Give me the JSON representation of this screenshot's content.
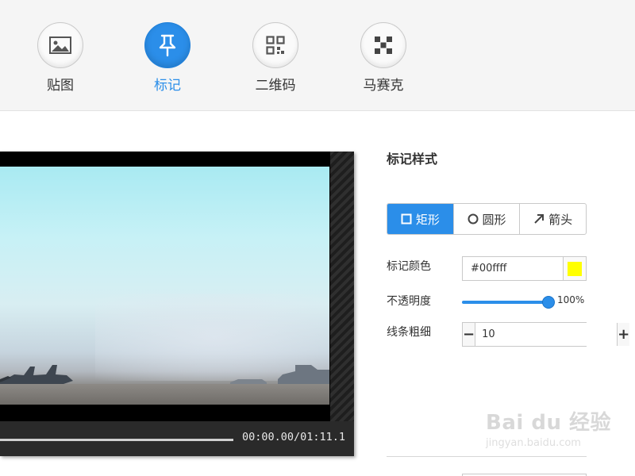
{
  "toolbar": {
    "tools": [
      {
        "label": "贴图",
        "icon": "image-icon",
        "active": false
      },
      {
        "label": "标记",
        "icon": "pin-icon",
        "active": true
      },
      {
        "label": "二维码",
        "icon": "qrcode-icon",
        "active": false
      },
      {
        "label": "马赛克",
        "icon": "mosaic-icon",
        "active": false
      }
    ]
  },
  "video": {
    "time": "00:00.00/01:11.1"
  },
  "panel": {
    "title": "标记样式",
    "shapes": [
      {
        "label": "矩形",
        "icon": "square-icon",
        "active": true
      },
      {
        "label": "圆形",
        "icon": "circle-icon",
        "active": false
      },
      {
        "label": "箭头",
        "icon": "arrow-icon",
        "active": false
      }
    ],
    "color": {
      "label": "标记颜色",
      "value": "#00ffff",
      "swatch": "#ffff00"
    },
    "opacity": {
      "label": "不透明度",
      "value": "100%",
      "level": 1.0
    },
    "line_width": {
      "label": "线条粗细",
      "value": "10"
    }
  },
  "watermark": {
    "main": "Bai du 经验",
    "sub": "jingyan.baidu.com"
  },
  "colors": {
    "accent": "#2b8ee9",
    "toolbar_bg": "#f5f5f5"
  }
}
